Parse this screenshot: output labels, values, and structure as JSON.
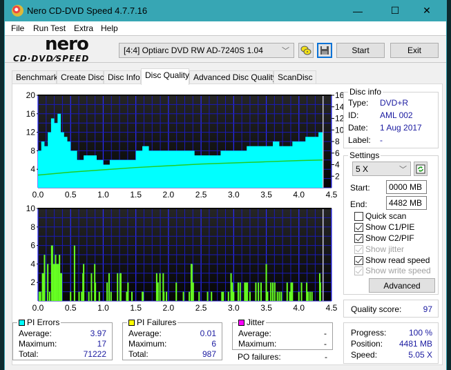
{
  "window": {
    "title": "Nero CD-DVD Speed 4.7.7.16",
    "controls": {
      "minimize": "—",
      "maximize": "☐",
      "close": "✕"
    }
  },
  "menu": [
    "File",
    "Run Test",
    "Extra",
    "Help"
  ],
  "logo": {
    "top": "nero",
    "bottom": "CD·DVD⁄SPEED"
  },
  "toolbar": {
    "drive": "[4:4]  Optiarc DVD RW AD-7240S 1.04",
    "start_label": "Start",
    "exit_label": "Exit"
  },
  "tabs": [
    {
      "label": "Benchmark",
      "active": false
    },
    {
      "label": "Create Disc",
      "active": false
    },
    {
      "label": "Disc Info",
      "active": false
    },
    {
      "label": "Disc Quality",
      "active": true
    },
    {
      "label": "Advanced Disc Quality",
      "active": false
    },
    {
      "label": "ScanDisc",
      "active": false
    }
  ],
  "disc_info": {
    "title": "Disc info",
    "type_label": "Type:",
    "type": "DVD+R",
    "id_label": "ID:",
    "id": "AML 002",
    "date_label": "Date:",
    "date": "1 Aug 2017",
    "label_label": "Label:",
    "label": "-"
  },
  "settings": {
    "title": "Settings",
    "speed": "5 X",
    "start_label": "Start:",
    "start": "0000 MB",
    "end_label": "End:",
    "end": "4482 MB",
    "checkboxes": [
      {
        "label": "Quick scan",
        "checked": false,
        "enabled": true
      },
      {
        "label": "Show C1/PIE",
        "checked": true,
        "enabled": true
      },
      {
        "label": "Show C2/PIF",
        "checked": true,
        "enabled": true
      },
      {
        "label": "Show jitter",
        "checked": true,
        "enabled": false
      },
      {
        "label": "Show read speed",
        "checked": true,
        "enabled": true
      },
      {
        "label": "Show write speed",
        "checked": true,
        "enabled": false
      }
    ],
    "advanced_label": "Advanced"
  },
  "quality": {
    "label": "Quality score:",
    "value": "97"
  },
  "progress": {
    "progress_label": "Progress:",
    "progress": "100 %",
    "position_label": "Position:",
    "position": "4481 MB",
    "speed_label": "Speed:",
    "speed": "5.05 X"
  },
  "pi_errors": {
    "title": "PI Errors",
    "color": "#00ffff",
    "average_label": "Average:",
    "average": "3.97",
    "maximum_label": "Maximum:",
    "maximum": "17",
    "total_label": "Total:",
    "total": "71222"
  },
  "pi_failures": {
    "title": "PI Failures",
    "color": "#ffff00",
    "average_label": "Average:",
    "average": "0.01",
    "maximum_label": "Maximum:",
    "maximum": "6",
    "total_label": "Total:",
    "total": "987"
  },
  "jitter": {
    "title": "Jitter",
    "color": "#ff00ff",
    "average_label": "Average:",
    "average": "-",
    "maximum_label": "Maximum:",
    "maximum": "-"
  },
  "po_failures": {
    "label": "PO failures:",
    "value": "-"
  },
  "chart_data": [
    {
      "type": "area",
      "title": "PI Errors",
      "xlim": [
        0,
        4.5
      ],
      "ylim": [
        0,
        20
      ],
      "y2lim": [
        0,
        16
      ],
      "x_ticks": [
        "0.0",
        "0.5",
        "1.0",
        "1.5",
        "2.0",
        "2.5",
        "3.0",
        "3.5",
        "4.0",
        "4.5"
      ],
      "y_ticks": [
        "4",
        "8",
        "12",
        "16",
        "20"
      ],
      "y2_ticks": [
        "2",
        "4",
        "6",
        "8",
        "10",
        "12",
        "14",
        "16"
      ],
      "grid": true,
      "series": [
        {
          "name": "PI Errors",
          "color": "#00ffff",
          "x": [
            0.0,
            0.05,
            0.1,
            0.15,
            0.2,
            0.25,
            0.3,
            0.35,
            0.4,
            0.45,
            0.5,
            0.6,
            0.7,
            0.8,
            0.9,
            1.0,
            1.1,
            1.2,
            1.3,
            1.4,
            1.5,
            1.6,
            1.7,
            1.8,
            1.9,
            2.0,
            2.1,
            2.2,
            2.3,
            2.4,
            2.5,
            2.6,
            2.7,
            2.8,
            2.9,
            3.0,
            3.1,
            3.2,
            3.3,
            3.4,
            3.5,
            3.6,
            3.7,
            3.8,
            3.9,
            4.0,
            4.1,
            4.2,
            4.3,
            4.37
          ],
          "values": [
            8,
            10,
            9,
            12,
            15,
            14,
            16,
            12,
            11,
            10,
            8,
            6,
            7,
            7,
            6,
            5,
            6,
            6,
            6,
            6,
            8,
            9,
            8,
            8,
            8,
            8,
            8,
            8,
            8,
            7,
            7,
            7,
            7,
            8,
            8,
            8,
            8,
            9,
            9,
            9,
            9,
            10,
            9,
            9,
            10,
            10,
            11,
            11,
            12,
            11
          ]
        },
        {
          "name": "Read Speed",
          "color": "#22cc22",
          "axis": "right",
          "x": [
            0.0,
            0.5,
            1.0,
            1.5,
            2.0,
            2.5,
            3.0,
            3.5,
            4.0,
            4.37
          ],
          "values": [
            2.2,
            2.7,
            3.1,
            3.5,
            3.8,
            4.1,
            4.3,
            4.5,
            4.7,
            4.8
          ]
        }
      ]
    },
    {
      "type": "bar",
      "title": "PI Failures",
      "xlim": [
        0,
        4.5
      ],
      "ylim": [
        0,
        10
      ],
      "x_ticks": [
        "0.0",
        "0.5",
        "1.0",
        "1.5",
        "2.0",
        "2.5",
        "3.0",
        "3.5",
        "4.0",
        "4.5"
      ],
      "y_ticks": [
        "2",
        "4",
        "6",
        "8",
        "10"
      ],
      "grid": true,
      "series": [
        {
          "name": "PI Failures",
          "color": "#66ff22",
          "x": [
            0.02,
            0.04,
            0.07,
            0.09,
            0.1,
            0.15,
            0.18,
            0.21,
            0.22,
            0.23,
            0.25,
            0.27,
            0.28,
            0.3,
            0.32,
            0.33,
            0.35,
            0.36,
            0.5,
            0.56,
            0.63,
            0.67,
            0.69,
            0.7,
            0.78,
            0.82,
            0.87,
            0.88,
            0.94,
            1.06,
            1.09,
            1.12,
            1.22,
            1.26,
            1.27,
            1.36,
            1.38,
            1.44,
            1.6,
            1.61,
            1.82,
            1.84,
            1.87,
            1.92,
            1.93,
            1.97,
            2.12,
            2.23,
            2.32,
            2.35,
            2.36,
            2.38,
            2.47,
            2.6,
            2.66,
            2.82,
            2.84,
            2.92,
            2.96,
            2.98,
            3.0,
            3.07,
            3.1,
            3.17,
            3.19,
            3.21,
            3.25,
            3.34,
            3.38,
            3.42,
            3.5,
            3.52,
            3.57,
            3.6,
            3.63,
            3.67,
            3.7,
            3.73,
            3.82,
            3.86,
            3.88,
            3.9,
            4.0,
            4.04,
            4.12,
            4.14,
            4.17,
            4.2,
            4.32,
            4.33
          ],
          "values": [
            1,
            1,
            3,
            3,
            5,
            4,
            1,
            6,
            6,
            4,
            4,
            5,
            4,
            4,
            4,
            5,
            3,
            3,
            1,
            6,
            1,
            1,
            3,
            4,
            1,
            3,
            4,
            2,
            1,
            2,
            3,
            1,
            3,
            3,
            3,
            1,
            2,
            1,
            1,
            1,
            3,
            2,
            3,
            3,
            1,
            1,
            2,
            1,
            1,
            4,
            4,
            2,
            1,
            1,
            1,
            1,
            1,
            1,
            3,
            2,
            1,
            2,
            2,
            2,
            2,
            2,
            1,
            2,
            2,
            2,
            4,
            1,
            2,
            2,
            2,
            1,
            1,
            1,
            2,
            1,
            2,
            2,
            1,
            2,
            2,
            1,
            1,
            1,
            3,
            2
          ]
        }
      ]
    }
  ]
}
